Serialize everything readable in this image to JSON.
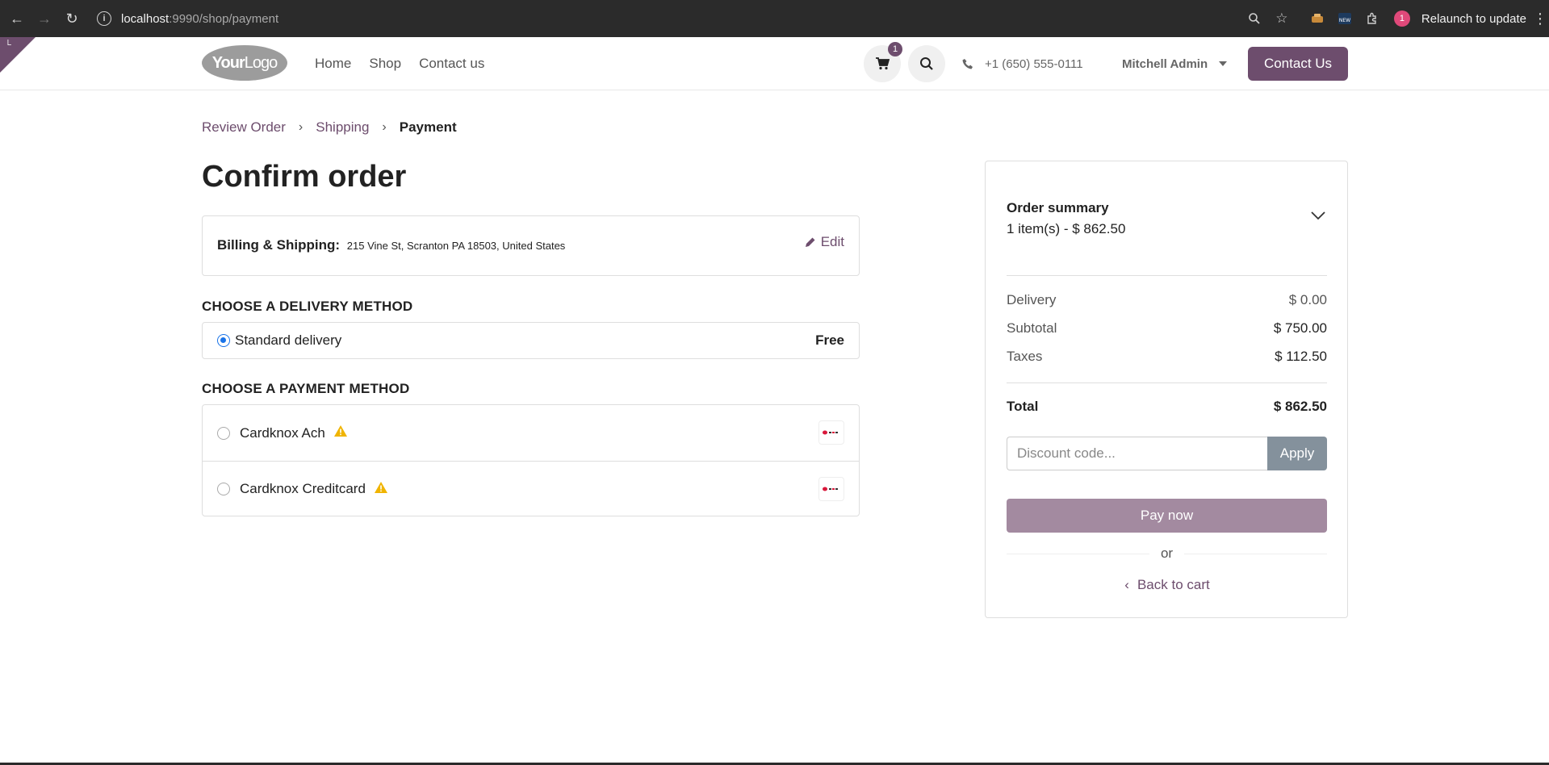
{
  "browser": {
    "url_host": "localhost",
    "url_path": ":9990/shop/payment",
    "relaunch_label": "Relaunch to update",
    "profile_initial": "1"
  },
  "header": {
    "logo_bold": "Your",
    "logo_thin": "Logo",
    "nav": [
      "Home",
      "Shop",
      "Contact us"
    ],
    "cart_count": "1",
    "phone": "+1 (650) 555-0111",
    "user_name": "Mitchell Admin",
    "contact_button": "Contact Us",
    "brand_color": "#6d4d6d"
  },
  "breadcrumb": {
    "items": [
      "Review Order",
      "Shipping",
      "Payment"
    ]
  },
  "page_title": "Confirm order",
  "billing": {
    "label": "Billing & Shipping:",
    "address": "215 Vine St, Scranton PA 18503, United States",
    "edit_label": "Edit"
  },
  "delivery": {
    "title": "CHOOSE A DELIVERY METHOD",
    "method": "Standard delivery",
    "price": "Free"
  },
  "payment": {
    "title": "CHOOSE A PAYMENT METHOD",
    "methods": [
      {
        "name": "Cardknox Ach"
      },
      {
        "name": "Cardknox Creditcard"
      }
    ]
  },
  "summary": {
    "title": "Order summary",
    "items_text": "1 item(s) -  $ 862.50",
    "delivery_label": "Delivery",
    "delivery_value": "$ 0.00",
    "subtotal_label": "Subtotal",
    "subtotal_value": "$ 750.00",
    "taxes_label": "Taxes",
    "taxes_value": "$ 112.50",
    "total_label": "Total",
    "total_value": "$ 862.50",
    "discount_placeholder": "Discount code...",
    "apply_label": "Apply",
    "pay_label": "Pay now",
    "or_label": "or",
    "back_label": "Back to cart"
  }
}
